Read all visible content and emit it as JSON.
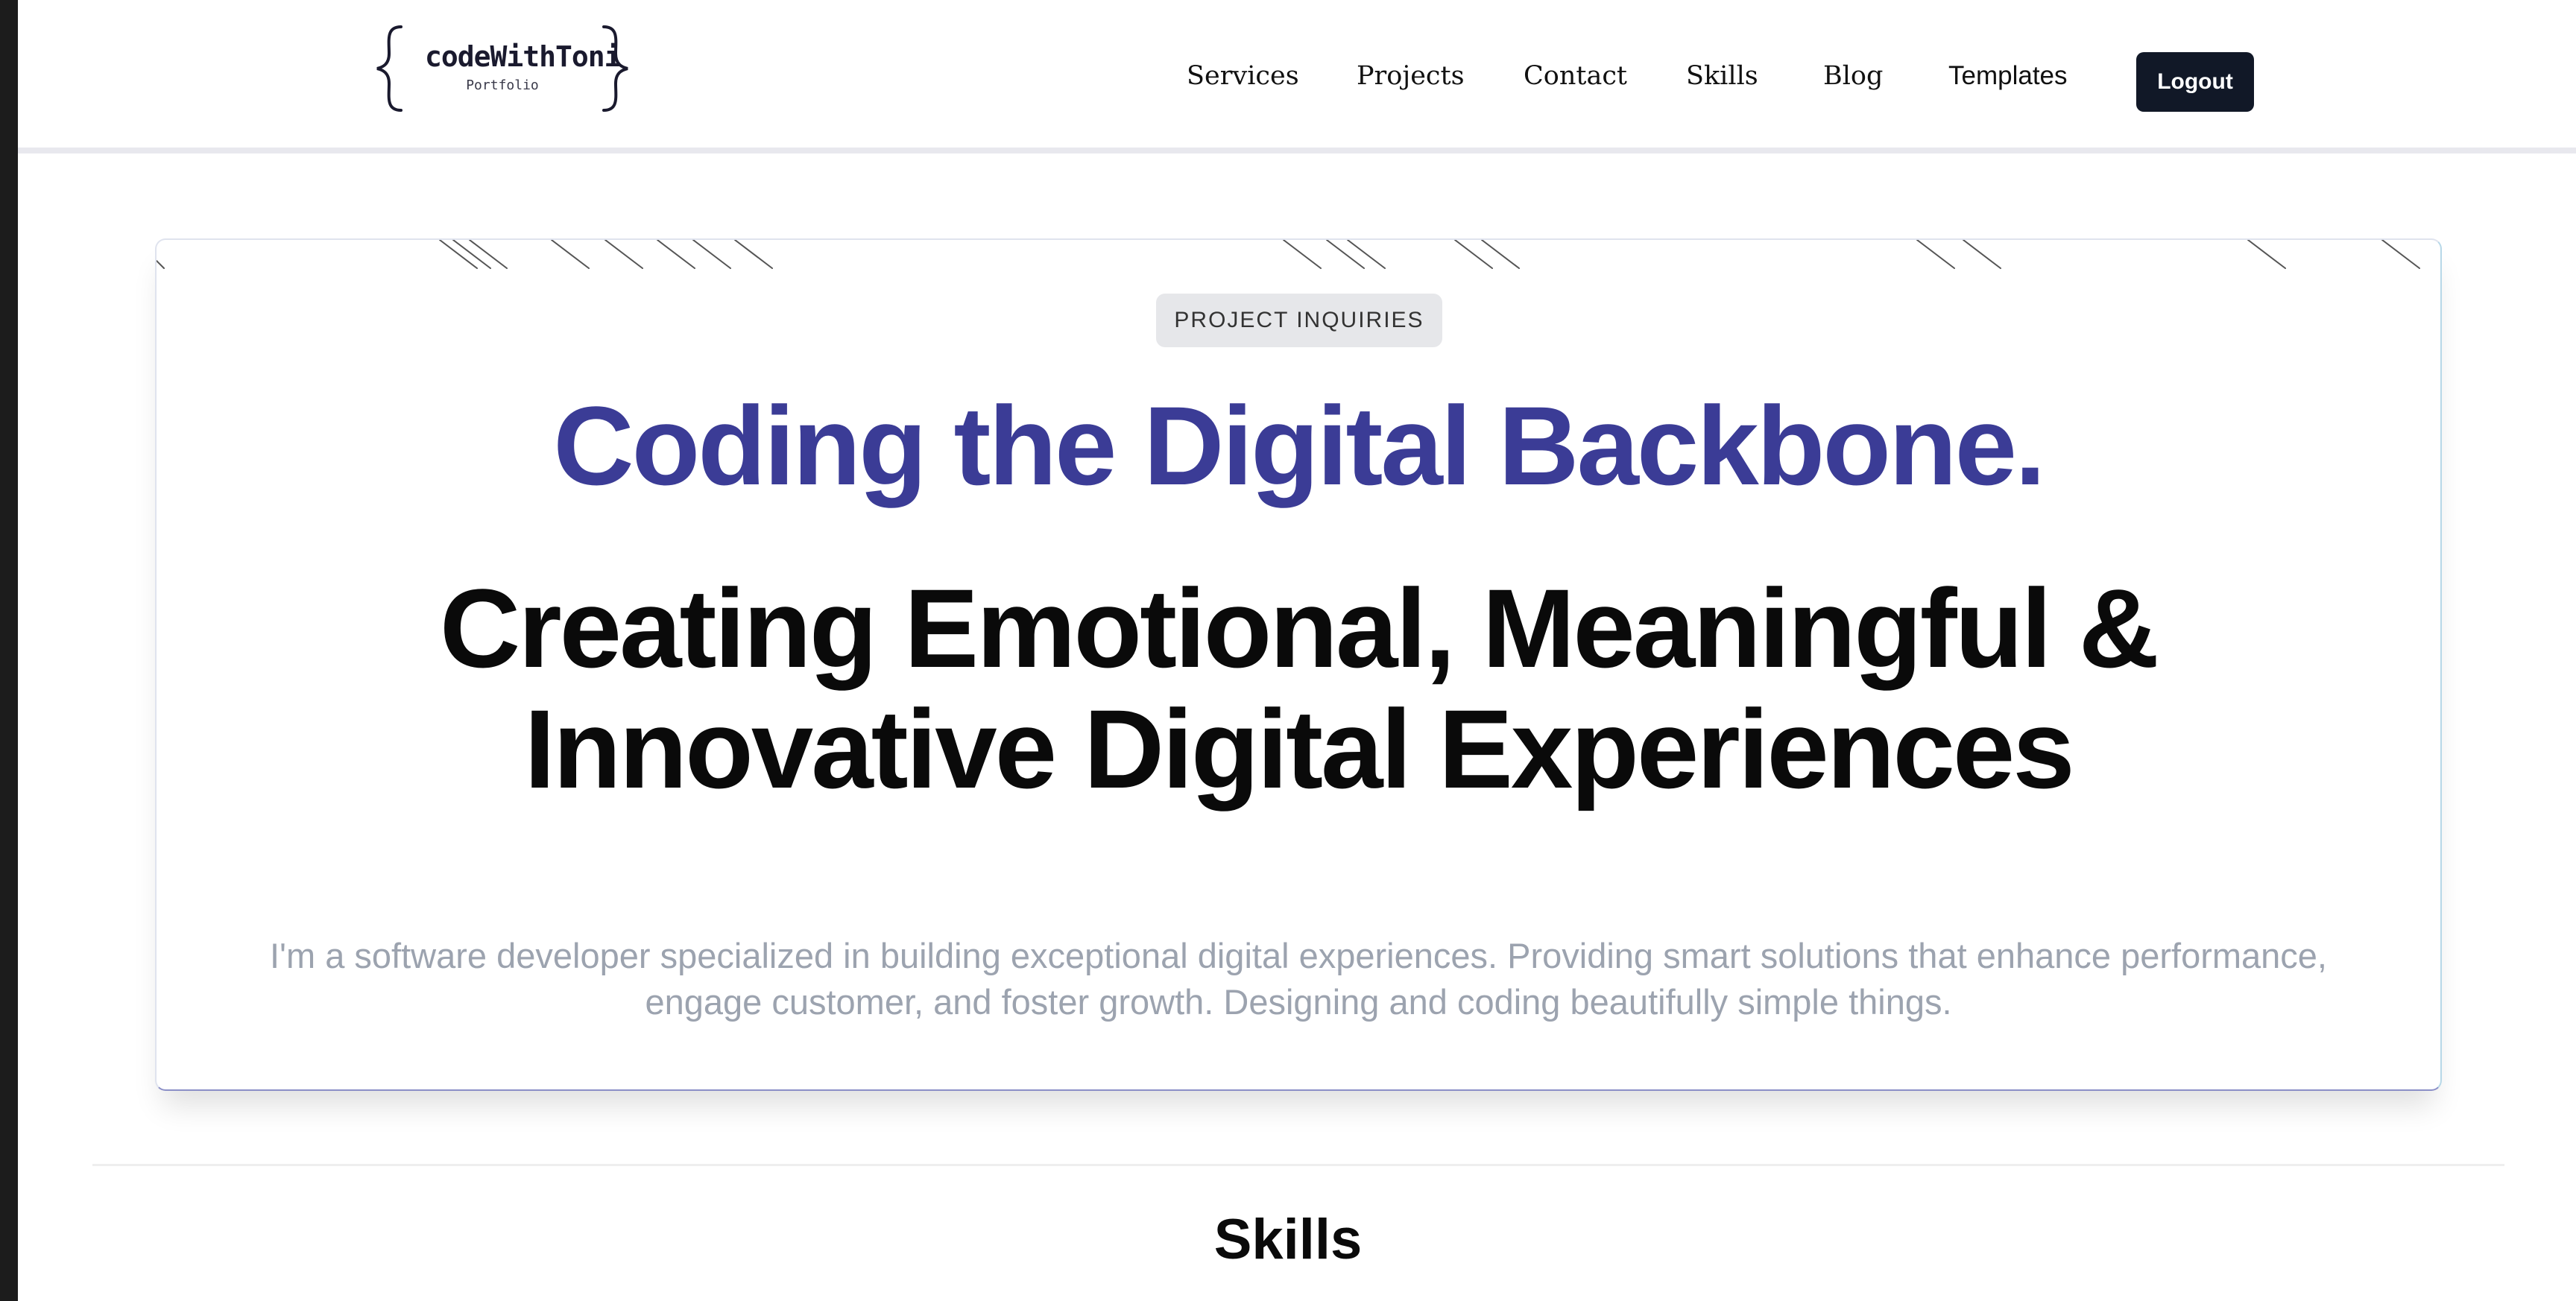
{
  "logo": {
    "title": "codeWithToni",
    "subtitle": "Portfolio"
  },
  "nav": {
    "items": [
      "Services",
      "Projects",
      "Contact",
      "Skills",
      "Blog",
      "Templates"
    ],
    "logout_label": "Logout"
  },
  "hero": {
    "badge": "PROJECT INQUIRIES",
    "headline_primary": "Coding the Digital Backbone.",
    "headline_secondary_line1": "Creating Emotional, Meaningful &",
    "headline_secondary_line2": "Innovative Digital Experiences",
    "description": "I'm a software developer specialized in building exceptional digital experiences. Providing smart solutions that enhance performance, engage customer, and foster growth. Designing and coding beautifully simple things."
  },
  "sections": {
    "skills_title": "Skills"
  },
  "colors": {
    "accent_headline": "#3b3c96",
    "button_bg": "#111827",
    "muted_text": "#9ca3af"
  }
}
